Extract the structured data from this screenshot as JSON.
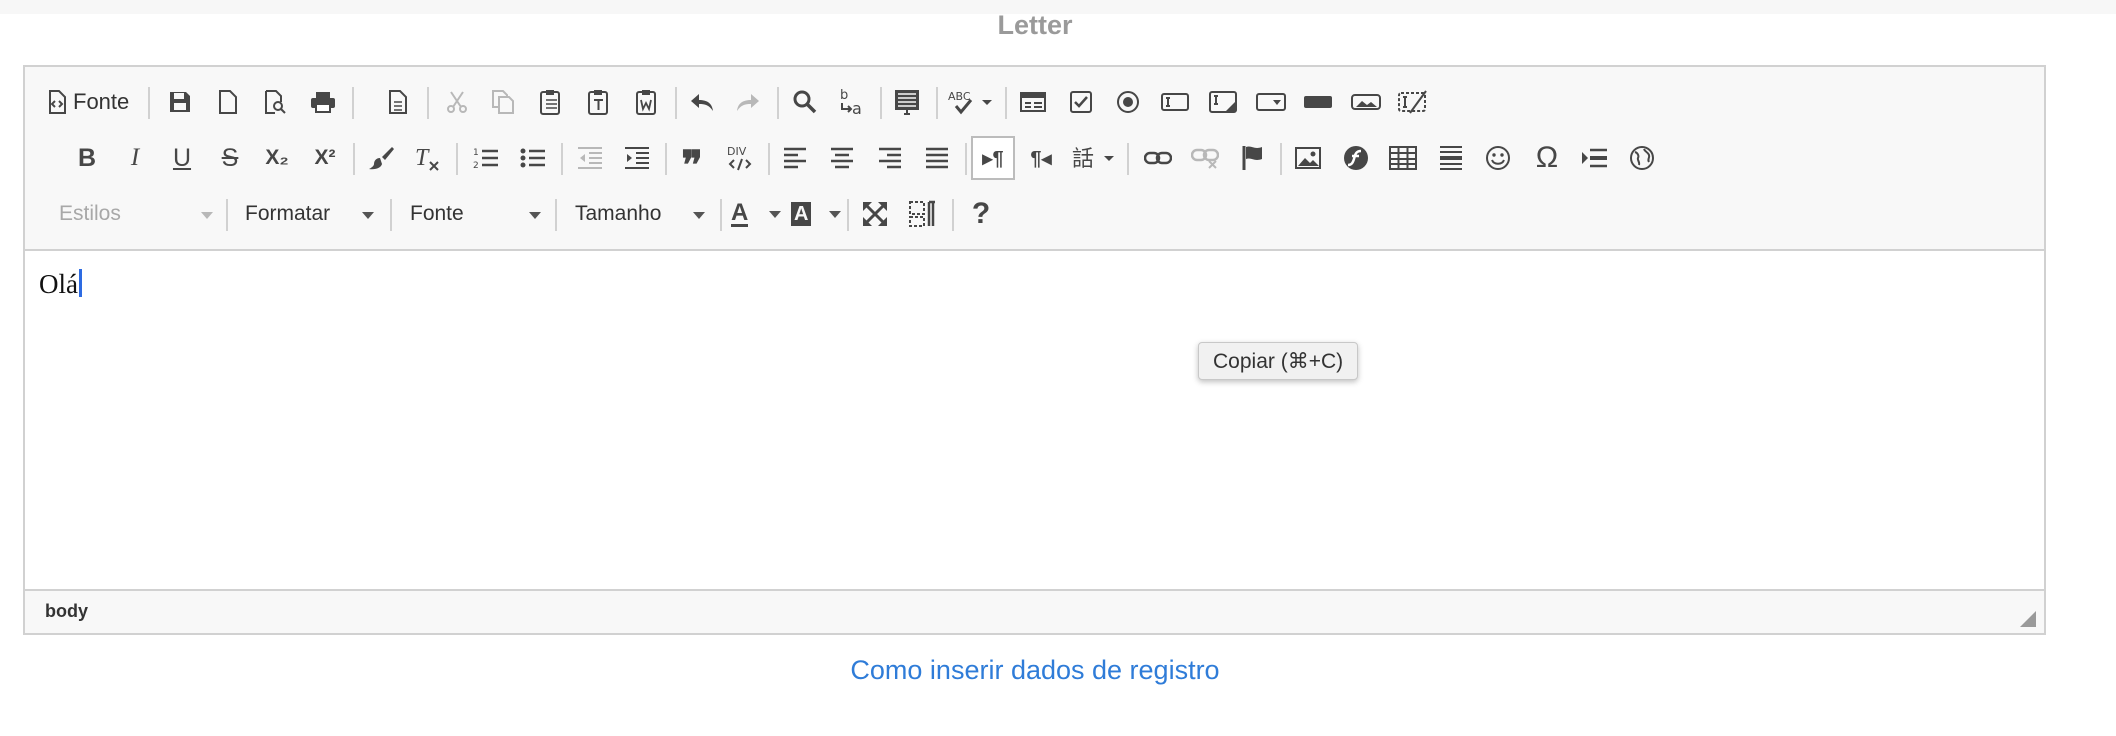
{
  "page": {
    "title": "Letter",
    "link_text": "Como inserir dados de registro"
  },
  "toolbar": {
    "source_label": "Fonte",
    "styles_label": "Estilos",
    "format_label": "Formatar",
    "font_label": "Fonte",
    "size_label": "Tamanho"
  },
  "editor": {
    "content": "Olá",
    "tooltip": "Copiar (⌘+C)",
    "element_path": "body"
  },
  "icons": {
    "bold": "B",
    "italic": "I",
    "underline": "U",
    "strike": "S",
    "subscript": "X₂",
    "superscript": "X²",
    "blockquote": "❞",
    "div": "DIV",
    "ltr": "▸¶",
    "rtl": "¶◂",
    "special_char": "Ω",
    "help": "?",
    "text_color": "A",
    "bg_color": "A",
    "spell": "ABC"
  },
  "colors": {
    "link": "#2f7cd8",
    "heading": "#9a9a9a",
    "toolbar_bg": "#f8f8f8",
    "border": "#d1d1d1"
  }
}
